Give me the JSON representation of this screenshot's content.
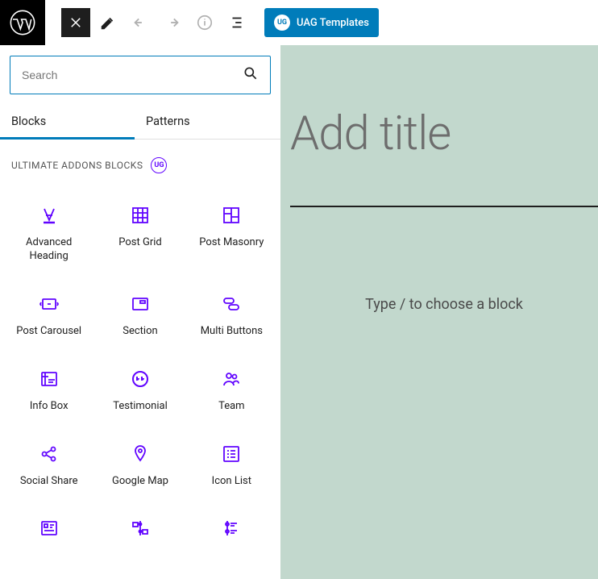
{
  "topbar": {
    "uag_button_label": "UAG Templates",
    "uag_badge": "UG"
  },
  "sidebar": {
    "search": {
      "placeholder": "Search"
    },
    "tabs": {
      "blocks": "Blocks",
      "patterns": "Patterns"
    },
    "category": {
      "title": "ULTIMATE ADDONS BLOCKS",
      "badge": "UG"
    },
    "blocks": [
      {
        "label": "Advanced Heading",
        "icon": "advanced-heading"
      },
      {
        "label": "Post Grid",
        "icon": "post-grid"
      },
      {
        "label": "Post Masonry",
        "icon": "post-masonry"
      },
      {
        "label": "Post Carousel",
        "icon": "post-carousel"
      },
      {
        "label": "Section",
        "icon": "section"
      },
      {
        "label": "Multi Buttons",
        "icon": "multi-buttons"
      },
      {
        "label": "Info Box",
        "icon": "info-box"
      },
      {
        "label": "Testimonial",
        "icon": "testimonial"
      },
      {
        "label": "Team",
        "icon": "team"
      },
      {
        "label": "Social Share",
        "icon": "social-share"
      },
      {
        "label": "Google Map",
        "icon": "google-map"
      },
      {
        "label": "Icon List",
        "icon": "icon-list"
      },
      {
        "label": "",
        "icon": "price-list"
      },
      {
        "label": "",
        "icon": "post-timeline"
      },
      {
        "label": "",
        "icon": "content-timeline"
      }
    ]
  },
  "canvas": {
    "title_placeholder": "Add title",
    "block_prompt": "Type / to choose a block"
  },
  "colors": {
    "accent": "#007cba",
    "block_icon": "#6104ff",
    "canvas_bg": "#c2d8cd"
  }
}
